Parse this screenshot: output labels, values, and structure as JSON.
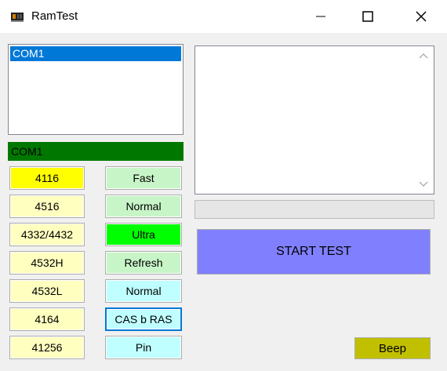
{
  "window": {
    "title": "RamTest",
    "icon": "memory-chip-icon"
  },
  "ports": {
    "items": [
      "COM1"
    ],
    "selected_index": 0,
    "status_text": "COM1"
  },
  "chips": [
    "4116",
    "4516",
    "4332/4432",
    "4532H",
    "4532L",
    "4164",
    "41256"
  ],
  "modes": [
    "Fast",
    "Normal",
    "Ultra",
    "Refresh",
    "Normal",
    "CAS b RAS",
    "Pin"
  ],
  "progress": {
    "value": 0
  },
  "actions": {
    "start_label": "START TEST",
    "beep_label": "Beep"
  },
  "colors": {
    "chip_selected": "#ffff00",
    "chip_default": "#ffffc0",
    "speed_default": "#c8f5c8",
    "speed_selected": "#00ff00",
    "ras_default": "#c0ffff",
    "status_bar": "#007800",
    "start_button": "#8080ff",
    "beep_button": "#c0c000"
  }
}
